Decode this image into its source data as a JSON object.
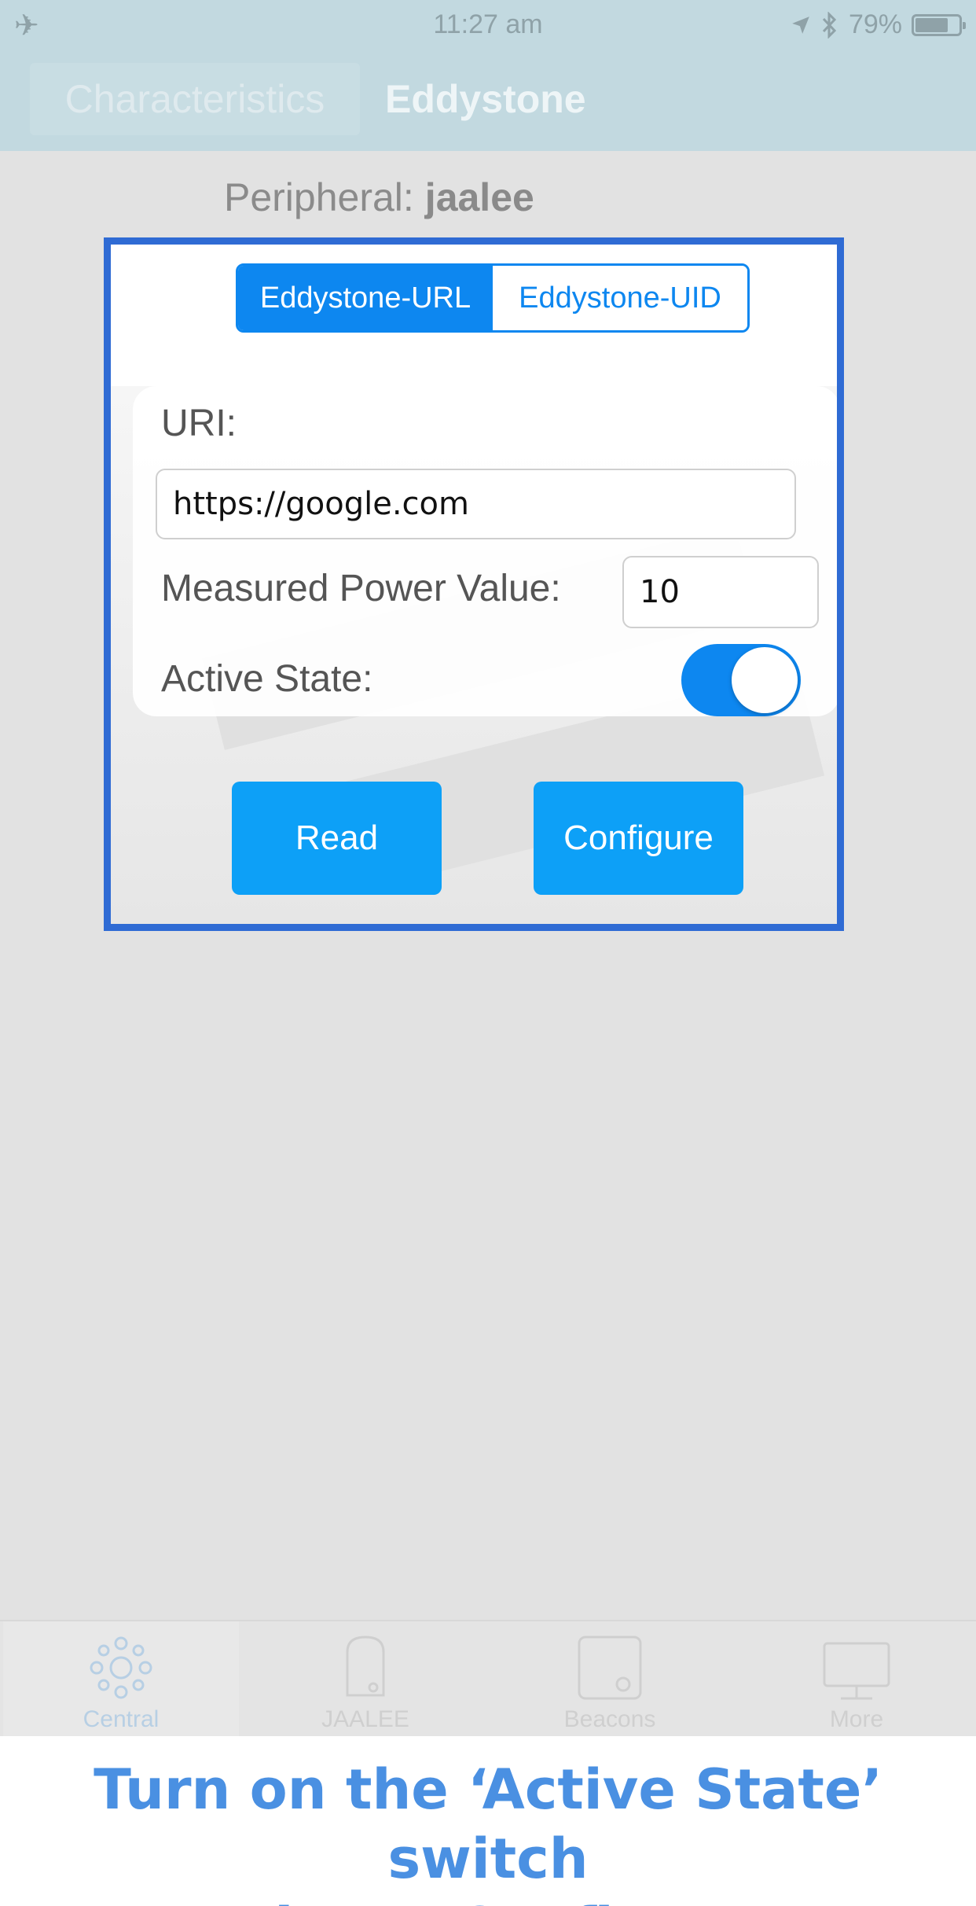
{
  "status_bar": {
    "time": "11:27 am",
    "battery_percent": "79%",
    "battery_level": 0.79,
    "icons": [
      "airplane-icon",
      "location-arrow-icon",
      "bluetooth-icon",
      "battery-icon"
    ]
  },
  "nav": {
    "back_tab_label": "Characteristics",
    "title": "Eddystone"
  },
  "peripheral": {
    "label": "Peripheral:",
    "name": "jaalee"
  },
  "segmented": {
    "options": [
      "Eddystone-URL",
      "Eddystone-UID"
    ],
    "selected": "Eddystone-URL"
  },
  "form": {
    "uri_label": "URI:",
    "uri_value": "https://google.com",
    "power_label": "Measured Power Value:",
    "power_value": "10",
    "active_label": "Active State:",
    "active_on": true
  },
  "buttons": {
    "read": "Read",
    "configure": "Configure"
  },
  "tab_bar": {
    "items": [
      {
        "label": "Central",
        "icon": "central-icon"
      },
      {
        "label": "JAALEE",
        "icon": "jaalee-icon"
      },
      {
        "label": "Beacons",
        "icon": "beacons-icon"
      },
      {
        "label": "More",
        "icon": "more-icon"
      }
    ],
    "selected": "Central"
  },
  "caption": {
    "line1": "Turn on the ‘Active State’ switch",
    "line2": "and tap ‘Configure’."
  },
  "colors": {
    "accent": "#0d87f0",
    "button": "#0da0f7",
    "highlight_border": "#2f6bd4",
    "caption": "#4a90e2",
    "nav_bg": "#c2d9e0"
  }
}
